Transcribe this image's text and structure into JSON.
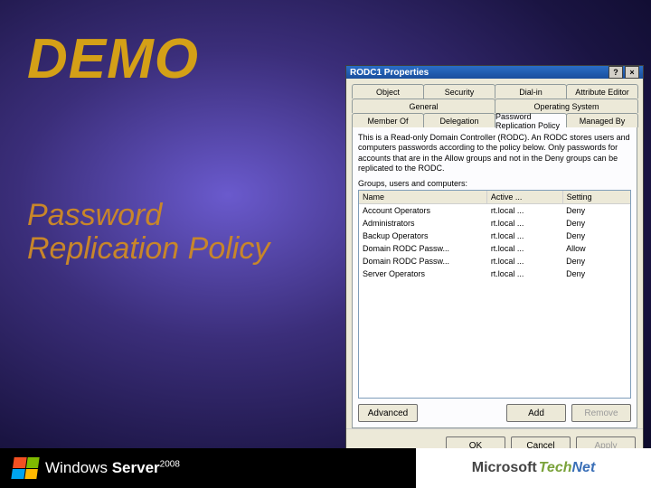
{
  "slide": {
    "demo_title": "DEMO",
    "subtitle_line1": "Password",
    "subtitle_line2": "Replication Policy"
  },
  "dialog": {
    "title": "RODC1 Properties",
    "help_btn": "?",
    "close_btn": "×",
    "tabs_row1": [
      "Object",
      "Security",
      "Dial-in",
      "Attribute Editor"
    ],
    "tabs_row2": [
      "General",
      "Operating System"
    ],
    "tabs_row3": [
      "Member Of",
      "Delegation",
      "Password Replication Policy",
      "Managed By"
    ],
    "active_tab": "Password Replication Policy",
    "description": "This is a Read-only Domain Controller (RODC). An RODC stores users and computers passwords according to the policy below. Only passwords for accounts that are in the Allow groups and not in the Deny groups can be replicated to the RODC.",
    "list_label": "Groups, users and computers:",
    "columns": {
      "name": "Name",
      "domain": "Active ...",
      "setting": "Setting"
    },
    "rows": [
      {
        "name": "Account Operators",
        "domain": "rt.local ...",
        "setting": "Deny"
      },
      {
        "name": "Administrators",
        "domain": "rt.local ...",
        "setting": "Deny"
      },
      {
        "name": "Backup Operators",
        "domain": "rt.local ...",
        "setting": "Deny"
      },
      {
        "name": "Domain RODC Passw...",
        "domain": "rt.local ...",
        "setting": "Allow"
      },
      {
        "name": "Domain RODC Passw...",
        "domain": "rt.local ...",
        "setting": "Deny"
      },
      {
        "name": "Server Operators",
        "domain": "rt.local ...",
        "setting": "Deny"
      }
    ],
    "buttons": {
      "advanced": "Advanced",
      "add": "Add",
      "remove": "Remove",
      "ok": "OK",
      "cancel": "Cancel",
      "apply": "Apply"
    }
  },
  "footer": {
    "ws_thin": "Windows",
    "ws_bold": "Server",
    "ws_year": "2008",
    "ms": "Microsoft",
    "tech": "Tech",
    "net": "Net"
  }
}
